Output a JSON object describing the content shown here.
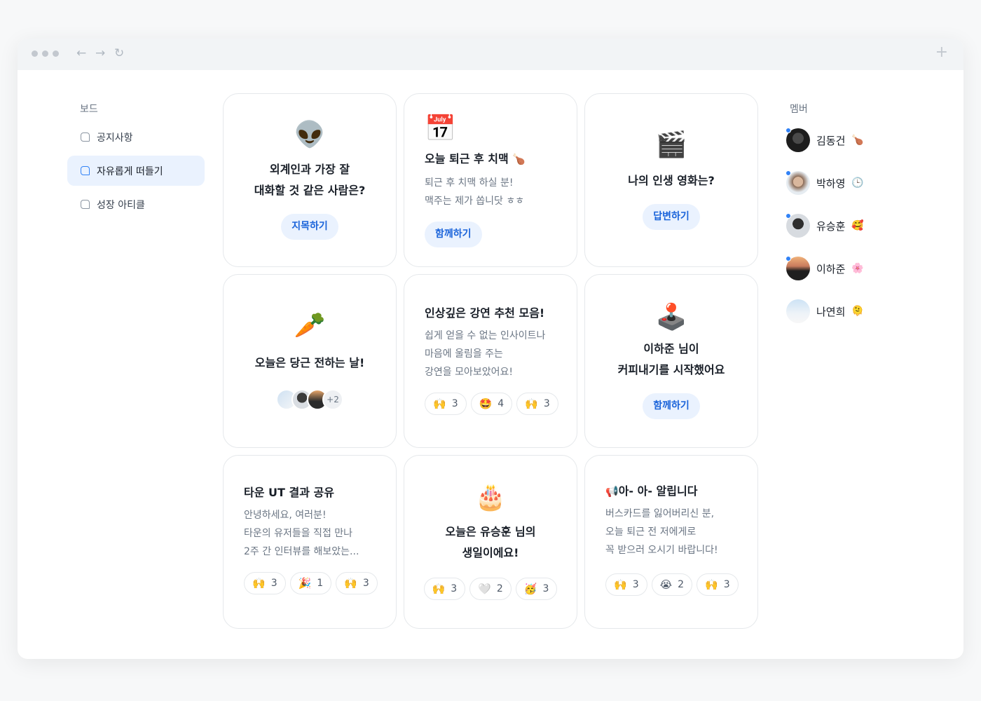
{
  "browser": {
    "back_icon": "←",
    "forward_icon": "→",
    "reload_icon": "↻",
    "new_tab_icon": "+"
  },
  "sidebar": {
    "title": "보드",
    "items": [
      {
        "label": "공지사항"
      },
      {
        "label": "자유롭게 떠들기"
      },
      {
        "label": "성장 아티클"
      }
    ]
  },
  "cards": [
    {
      "emoji": "👽",
      "title_line1": "외계인과 가장 잘",
      "title_line2": "대화할 것 같은 사람은?",
      "button": "지목하기"
    },
    {
      "emoji": "📅",
      "title": "오늘 퇴근 후 치맥",
      "title_emoji": "🍗",
      "body_line1": "퇴근 후 치맥 하실 분!",
      "body_line2": "맥주는 제가 쏩니닷 ㅎㅎ",
      "button": "함께하기"
    },
    {
      "emoji": "🎬",
      "title": "나의 인생 영화는?",
      "button": "답변하기"
    },
    {
      "emoji": "🥕",
      "title": "오늘은 당근 전하는 날!",
      "more_count": "+2"
    },
    {
      "title": "인상깊은 강연 추천 모음!",
      "body_line1": "쉽게 얻을 수 없는 인사이트나",
      "body_line2": "마음에 울림을 주는",
      "body_line3": "강연을 모아보았어요!",
      "reactions": [
        {
          "emoji": "🙌",
          "count": "3"
        },
        {
          "emoji": "🤩",
          "count": "4"
        },
        {
          "emoji": "🙌",
          "count": "3"
        }
      ]
    },
    {
      "emoji": "🕹️",
      "title_line1": "이하준 님이",
      "title_line2": "커피내기를 시작했어요",
      "button": "함께하기"
    },
    {
      "title": "타운 UT 결과 공유",
      "body_line1": "안녕하세요, 여러분!",
      "body_line2": "타운의 유저들을 직접 만나",
      "body_line3": "2주 간 인터뷰를 해보았는...",
      "reactions": [
        {
          "emoji": "🙌",
          "count": "3"
        },
        {
          "emoji": "🎉",
          "count": "1"
        },
        {
          "emoji": "🙌",
          "count": "3"
        }
      ]
    },
    {
      "emoji": "🎂",
      "title_line1": "오늘은 유승훈 님의",
      "title_line2": "생일이에요!",
      "reactions": [
        {
          "emoji": "🙌",
          "count": "3"
        },
        {
          "emoji": "🤍",
          "count": "2"
        },
        {
          "emoji": "🥳",
          "count": "3"
        }
      ]
    },
    {
      "title_emoji": "📢",
      "title": "아- 아- 알립니다",
      "body_line1": "버스카드를 잃어버리신 분,",
      "body_line2": "오늘 퇴근 전 저에게로",
      "body_line3": "꼭 받으러 오시기 바랍니다!",
      "reactions": [
        {
          "emoji": "🙌",
          "count": "3"
        },
        {
          "emoji": "😭",
          "count": "2"
        },
        {
          "emoji": "🙌",
          "count": "3"
        }
      ]
    }
  ],
  "members": {
    "title": "멤버",
    "list": [
      {
        "name": "김동건",
        "status": "🍗"
      },
      {
        "name": "박하영",
        "status": "🕒"
      },
      {
        "name": "유승훈",
        "status": "🥰"
      },
      {
        "name": "이하준",
        "status": "🌸"
      },
      {
        "name": "나연희",
        "status": "🫠"
      }
    ]
  },
  "colors": {
    "accent": "#3182f6",
    "button_bg": "#eaf2fe",
    "button_text": "#1b64da",
    "card_border": "#e5e8eb"
  }
}
